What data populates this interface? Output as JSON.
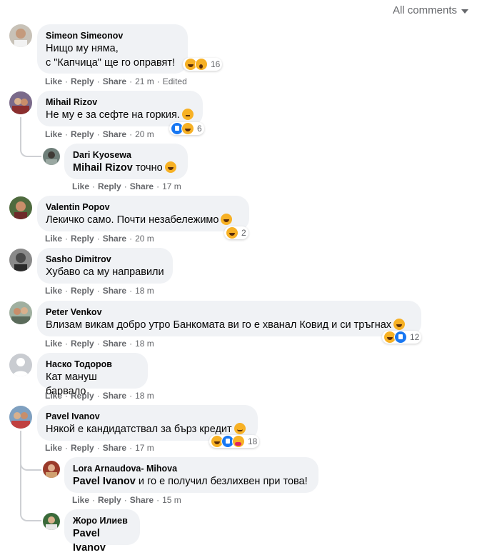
{
  "header": {
    "label": "All comments"
  },
  "actions": {
    "like": "Like",
    "reply": "Reply",
    "share": "Share",
    "sep": "·"
  },
  "comments": [
    {
      "name": "Simeon Simeonov",
      "text": "Нищо му няма,\nс \"Капчица\" ще го оправят!",
      "time": "21 m",
      "edited": "Edited",
      "reactions": {
        "types": [
          "haha",
          "wow"
        ],
        "count": "16"
      }
    },
    {
      "name": "Mihail Rizov",
      "text": "Не му е за сефте на горкия.",
      "emoji": "thinking-emoji",
      "time": "20 m",
      "reactions": {
        "types": [
          "like",
          "haha"
        ],
        "count": "6"
      }
    },
    {
      "name": "Dari Kyosewa",
      "mention": "Mihail Rizov",
      "text": " точно",
      "emoji": "grin-emoji",
      "time": "17 m"
    },
    {
      "name": "Valentin Popov",
      "text": "Лекичко само. Почти незабележимо",
      "emoji": "grin-emoji",
      "time": "20 m",
      "reactions": {
        "types": [
          "haha"
        ],
        "count": "2"
      }
    },
    {
      "name": "Sasho Dimitrov",
      "text": "Хубаво са му направили",
      "time": "18 m"
    },
    {
      "name": "Peter Venkov",
      "text": "Влизам викам добро утро Банкомата ви го е хванал Ковид и си тръгнах",
      "emoji": "grin-emoji",
      "time": "18 m",
      "reactions": {
        "types": [
          "haha",
          "like"
        ],
        "count": "12"
      }
    },
    {
      "name": "Наско Тодоров",
      "text": "Кат мануш барвало",
      "time": "18 m"
    },
    {
      "name": "Pavel Ivanov",
      "text": "Някой е кандидатствал за бърз кредит",
      "emoji": "smile-emoji",
      "time": "17 m",
      "reactions": {
        "types": [
          "haha",
          "like",
          "care"
        ],
        "count": "18"
      }
    },
    {
      "name": "Lora Arnaudova- Mihova",
      "mention": "Pavel Ivanov",
      "text": " и го е получил безлихвен при това!",
      "time": "15 m"
    },
    {
      "name": "Жоро Илиев",
      "mention": "Pavel Ivanov",
      "text": ""
    }
  ],
  "colors": {
    "bubble": "#f0f2f5",
    "meta": "#65676b",
    "like": "#1877f2",
    "haha": "#f7b125"
  }
}
